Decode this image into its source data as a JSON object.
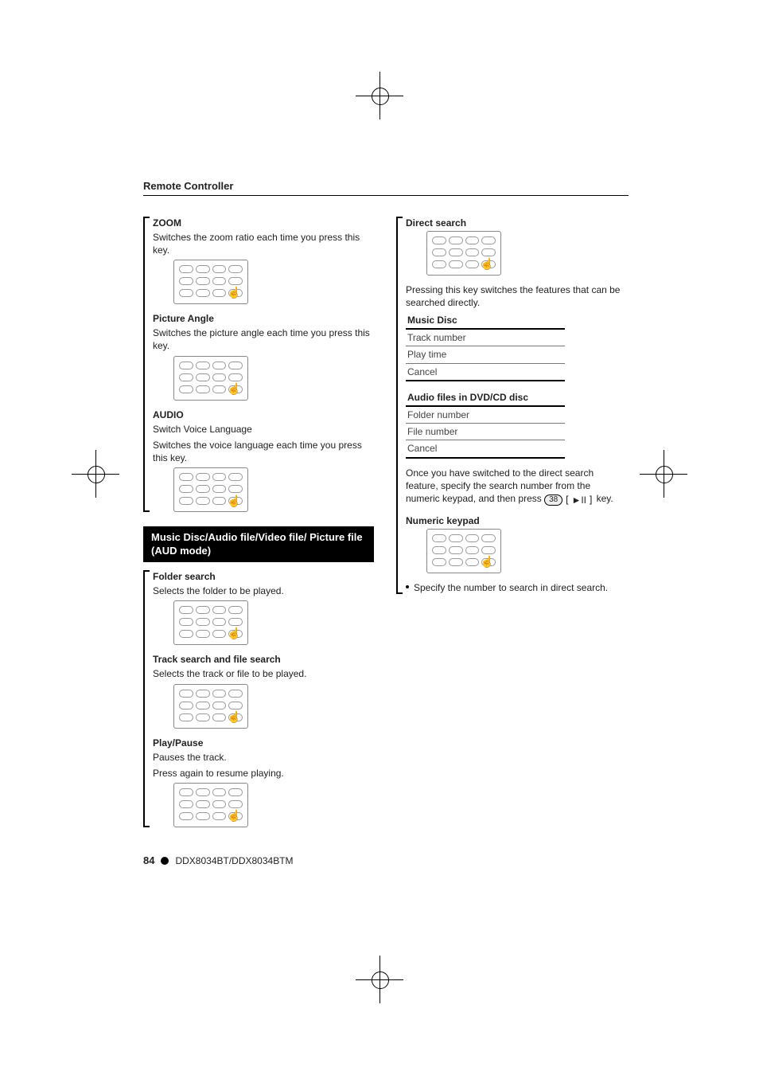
{
  "page": {
    "number": "84",
    "model_line": "DDX8034BT/DDX8034BTM",
    "section": "Remote Controller"
  },
  "left": {
    "zoom": {
      "title": "ZOOM",
      "desc": "Switches the zoom ratio each time you press this key."
    },
    "picture_angle": {
      "title": "Picture Angle",
      "desc": "Switches the picture angle each time you press this key."
    },
    "audio": {
      "title": "AUDIO",
      "line1": "Switch Voice Language",
      "line2": "Switches the voice language each time you press this key."
    },
    "mode_heading": "Music Disc/Audio file/Video file/ Picture file (AUD mode)",
    "folder_search": {
      "title": "Folder search",
      "desc": "Selects the folder to be played."
    },
    "track_search": {
      "title": "Track search and file search",
      "desc": "Selects the track or file to be played."
    },
    "play_pause": {
      "title": "Play/Pause",
      "line1": "Pauses the track.",
      "line2": "Press again to resume playing."
    }
  },
  "right": {
    "direct_search": {
      "title": "Direct search",
      "desc": "Pressing this key switches the features that can be searched directly."
    },
    "table_music": {
      "heading": "Music Disc",
      "rows": [
        "Track number",
        "Play time",
        "Cancel"
      ]
    },
    "table_audio": {
      "heading": "Audio files in DVD/CD disc",
      "rows": [
        "Folder number",
        "File number",
        "Cancel"
      ]
    },
    "after_tables": {
      "prefix": "Once you have switched to the direct search feature, specify the search number from the numeric keypad, and then press ",
      "key_symbol": "►II",
      "suffix": " key."
    },
    "numeric": {
      "title": "Numeric keypad",
      "bullet": "Specify the number to search in direct search."
    }
  }
}
